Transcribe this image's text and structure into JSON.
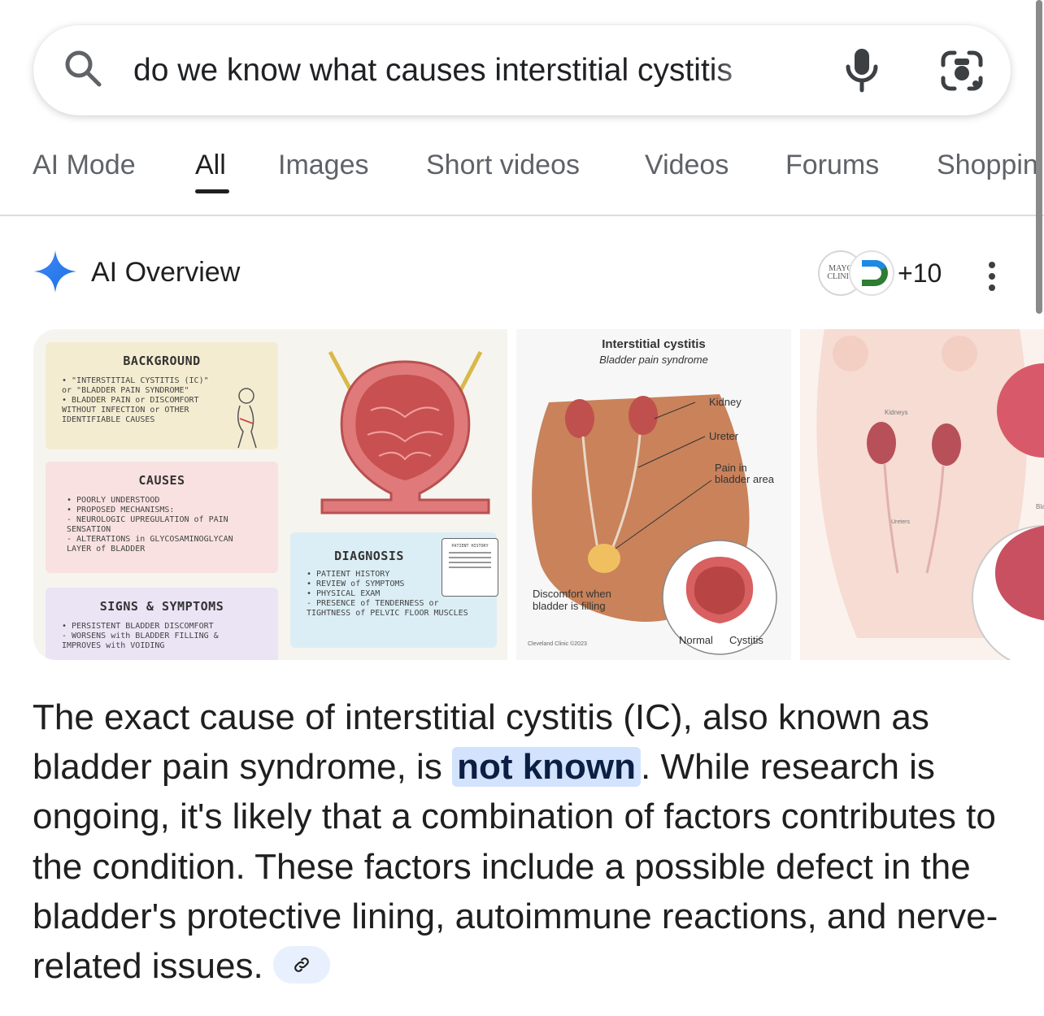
{
  "search": {
    "query": "do we know what causes interstitial cystitis"
  },
  "tabs": [
    {
      "label": "AI Mode"
    },
    {
      "label": "All"
    },
    {
      "label": "Images"
    },
    {
      "label": "Short videos"
    },
    {
      "label": "Videos"
    },
    {
      "label": "Forums"
    },
    {
      "label": "Shoppin"
    }
  ],
  "active_tab": "All",
  "ai_overview": {
    "title": "AI Overview",
    "sources_more": "+10",
    "source_logo_text": "MAYO CLINIC",
    "accent_color": "#4285f4"
  },
  "images": {
    "card1": {
      "background_title": "BACKGROUND",
      "background_body": "• \"INTERSTITIAL CYSTITIS (IC)\" or \"BLADDER PAIN SYNDROME\"\n• BLADDER PAIN or DISCOMFORT WITHOUT INFECTION or OTHER IDENTIFIABLE CAUSES",
      "causes_title": "CAUSES",
      "causes_body": "• POORLY UNDERSTOOD\n• PROPOSED MECHANISMS:\n  - NEUROLOGIC UPREGULATION of PAIN SENSATION\n  - ALTERATIONS in GLYCOSAMINOGLYCAN LAYER of BLADDER",
      "signs_title": "SIGNS & SYMPTOMS",
      "signs_body": "• PERSISTENT BLADDER DISCOMFORT\n  - WORSENS with BLADDER FILLING & IMPROVES with VOIDING",
      "diagnosis_title": "DIAGNOSIS",
      "diagnosis_body": "• PATIENT HISTORY\n• REVIEW of SYMPTOMS\n• PHYSICAL EXAM\n  - PRESENCE of TENDERNESS or TIGHTNESS of PELVIC FLOOR MUSCLES",
      "clipboard_label": "PATIENT HISTORY"
    },
    "card2": {
      "title": "Interstitial cystitis",
      "subtitle": "Bladder pain syndrome",
      "label_kidney": "Kidney",
      "label_ureter": "Ureter",
      "label_pain": "Pain in\nbladder area",
      "label_discomfort": "Discomfort when\nbladder is filling",
      "label_normal": "Normal",
      "label_cystitis": "Cystitis",
      "credit": "Cleveland Clinic ©2023"
    },
    "card3": {
      "label_kidneys": "Kidneys",
      "label_ureters": "Ureters",
      "label_bladder": "Bladd"
    }
  },
  "answer": {
    "before": "The exact cause of interstitial cystitis (IC), also known as bladder pain syndrome, is ",
    "highlight": "not known",
    "after": ". While research is ongoing, it's likely that a combination of factors contributes to the condition. These factors include a possible defect in the bladder's protective lining, autoimmune reactions, and nerve-related issues."
  }
}
